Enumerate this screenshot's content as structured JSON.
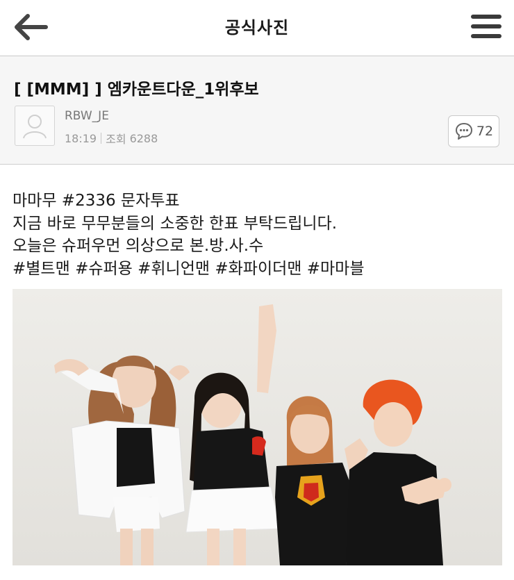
{
  "appbar": {
    "title": "공식사진",
    "back_icon": "arrow-left-icon",
    "menu_icon": "hamburger-menu-icon"
  },
  "post": {
    "title": "[ [MMM] ] 엠카운트다운_1위후보",
    "author": "RBW_JE",
    "time": "18:19",
    "views_label": "조회",
    "views": "6288",
    "comment_count": "72",
    "avatar_icon": "user-placeholder-icon",
    "comment_icon": "speech-bubble-icon"
  },
  "body": {
    "lines": [
      "마마무 #2336 문자투표",
      "지금 바로 무무분들의 소중한 한표 부탁드립니다.",
      "오늘은 슈퍼우먼 의상으로 본.방.사.수",
      "#별트맨 #슈퍼용 #휘니언맨 #화파이더맨 #마마블"
    ]
  },
  "colors": {
    "divider": "#c9c9c9",
    "header_bg": "#f6f6f6",
    "text": "#1a1a1a",
    "muted": "#999999",
    "photo_bg": "#ecebe7"
  }
}
